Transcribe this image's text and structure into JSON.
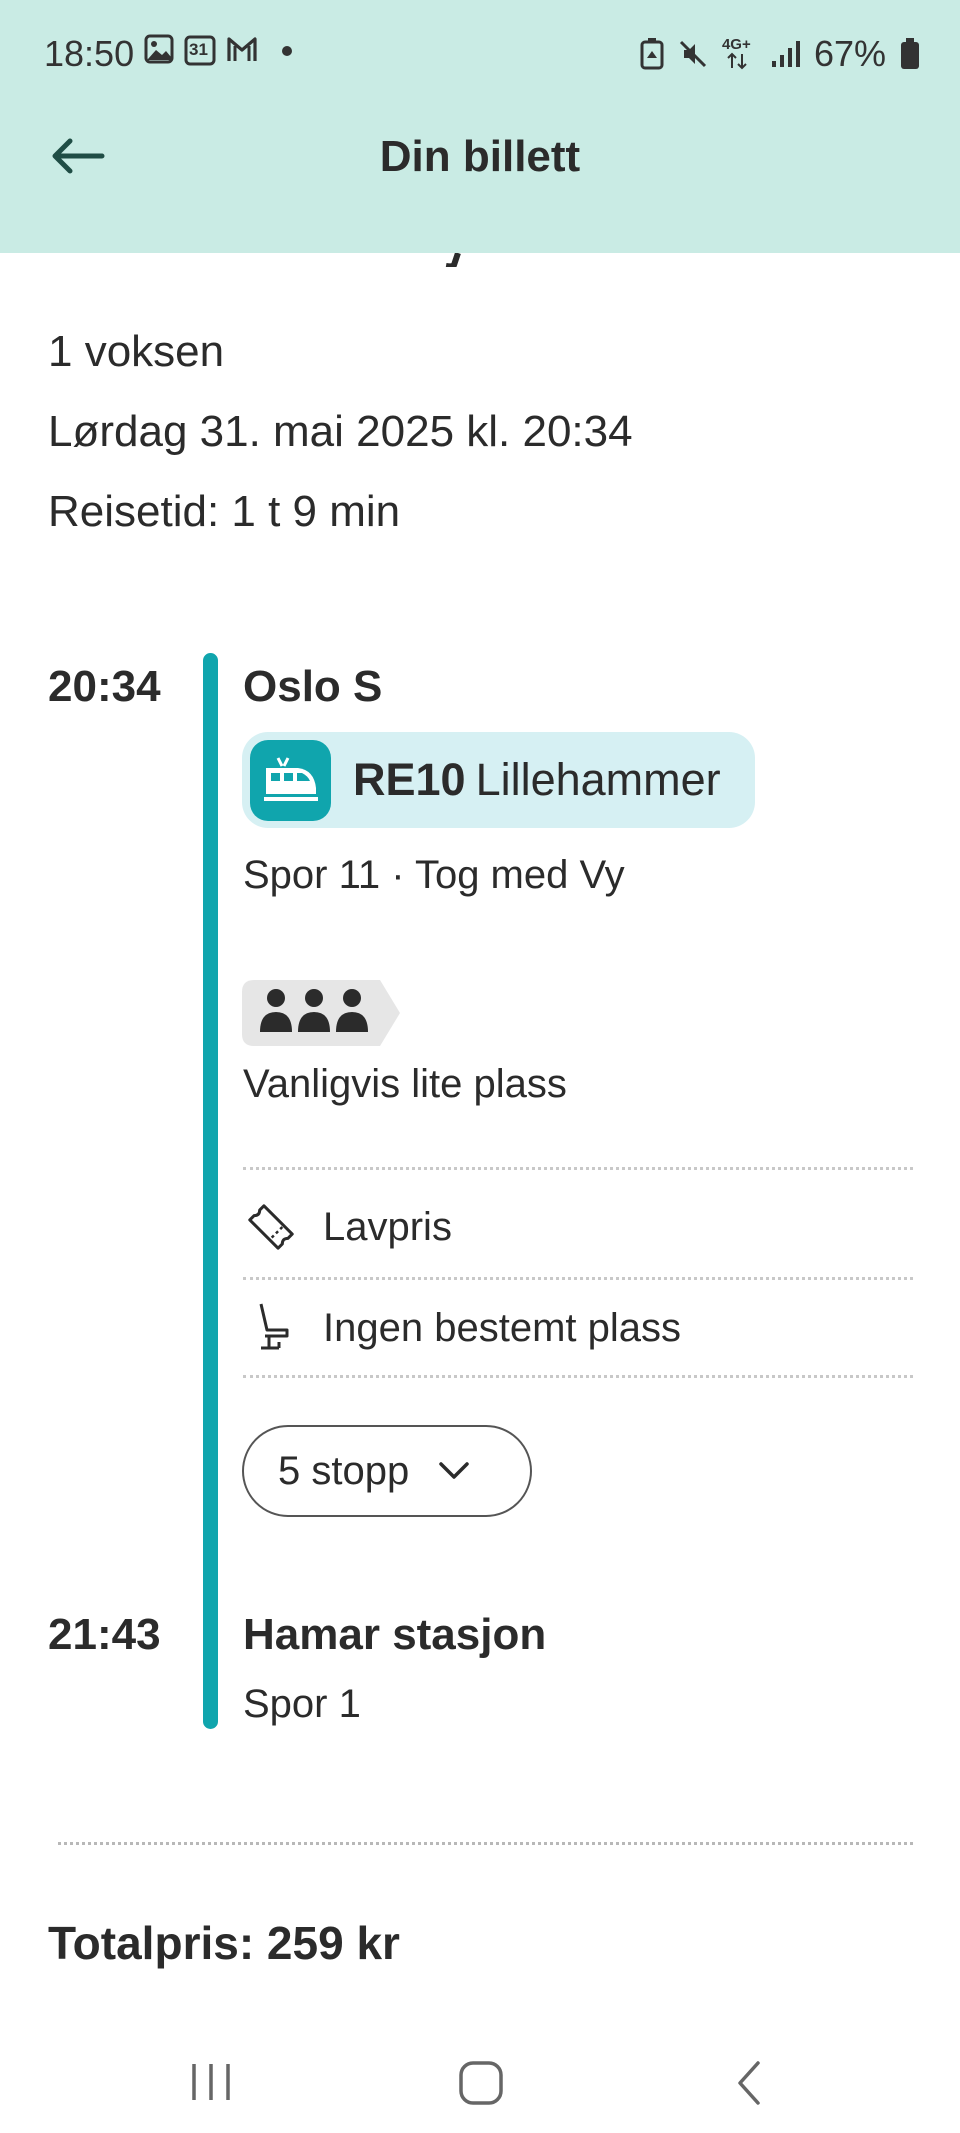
{
  "status_bar": {
    "time": "18:50",
    "calendar_day": "31",
    "battery": "67%",
    "network": "4G+"
  },
  "header": {
    "title": "Din billett",
    "back_icon": "arrow-left-icon"
  },
  "ticket": {
    "passengers": "1 voksen",
    "date": "Lørdag 31. mai 2025 kl. 20:34",
    "travel_time": "Reisetid: 1 t 9 min"
  },
  "journey": {
    "departure": {
      "time": "20:34",
      "station": "Oslo S"
    },
    "train": {
      "line": "RE10",
      "destination": "Lillehammer",
      "icon": "train-icon"
    },
    "track_info": "Spor 11 · Tog med Vy",
    "crowding": {
      "icon": "people-icon",
      "label": "Vanligvis lite plass"
    },
    "features": [
      {
        "icon": "ticket-icon",
        "label": "Lavpris"
      },
      {
        "icon": "seat-icon",
        "label": "Ingen bestemt plass"
      }
    ],
    "stops_button": "5 stopp",
    "arrival": {
      "time": "21:43",
      "station": "Hamar stasjon",
      "track": "Spor 1"
    }
  },
  "total_price": "Totalpris: 259 kr",
  "colors": {
    "header_bg": "#c9ebe4",
    "accent": "#10a5ad",
    "pill_bg": "#d6f0f3",
    "text": "#2b2b2b"
  }
}
